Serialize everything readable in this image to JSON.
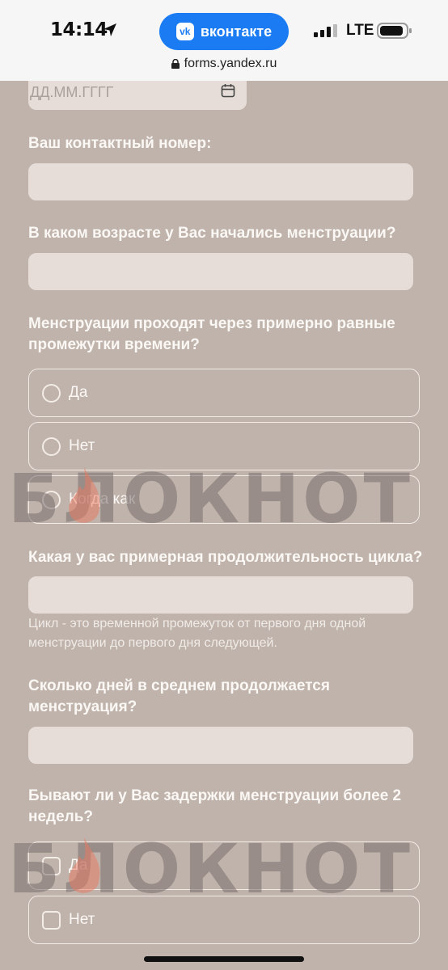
{
  "status_bar": {
    "time": "14:14",
    "back_app": "вконтакте",
    "vk_logo": "vk",
    "network": "LTE",
    "url": "forms.yandex.ru"
  },
  "form": {
    "date_placeholder": "ДД.ММ.ГГГГ",
    "q_phone": "Ваш контактный номер:",
    "q_age": "В каком возрасте у Вас начались менструации?",
    "q_regular": "Менструации проходят через примерно равные промежутки времени?",
    "regular_options": [
      "Да",
      "Нет",
      "Когда как"
    ],
    "q_cycle": "Какая у вас примерная продолжительность цикла?",
    "cycle_hint": "Цикл - это временной промежуток от первого дня одной менструации до первого дня следующей.",
    "q_days": "Сколько дней в среднем продолжается менструация?",
    "q_delay": "Бывают ли у Вас задержки менструации более 2 недель?",
    "delay_options": [
      "Да",
      "Нет"
    ]
  },
  "watermark": {
    "text": "БЛОКНОТ"
  },
  "colors": {
    "background": "#bfb3ab",
    "input_bg": "#e6ddd8",
    "accent_vk": "#1a7bf3"
  }
}
